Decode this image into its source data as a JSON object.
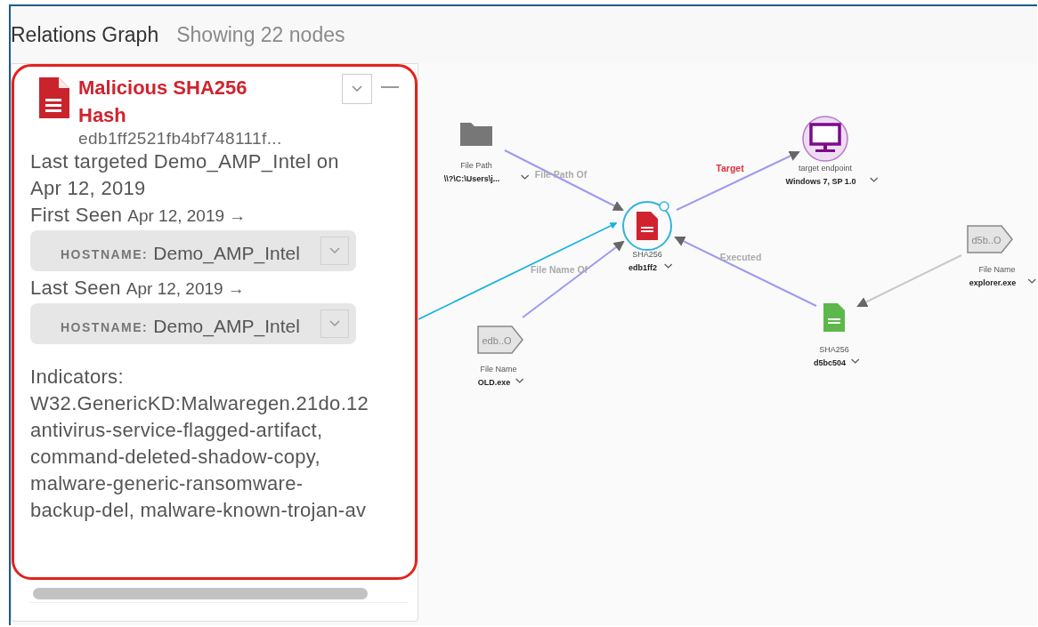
{
  "header": {
    "title": "Relations Graph",
    "subtitle": "Showing 22 nodes"
  },
  "panel": {
    "title": "Malicious SHA256 Hash",
    "hash": "edb1ff2521fb4bf748111f...",
    "summary": "Last targeted Demo_AMP_Intel on Apr 12, 2019",
    "sightings": [
      {
        "label": "First Seen",
        "date": "Apr 12, 2019 →",
        "host_key": "HOSTNAME:",
        "host": "Demo_AMP_Intel"
      },
      {
        "label": "Last Seen",
        "date": "Apr 12, 2019 →",
        "host_key": "HOSTNAME:",
        "host": "Demo_AMP_Intel"
      }
    ],
    "indicators_label": "Indicators:",
    "indicators": "W32.GenericKD:Malwaregen.21do.12 antivirus-service-flagged-artifact, command-deleted-shadow-copy, malware-generic-ransomware-backup-del, malware-known-trojan-av"
  },
  "graph": {
    "nodes": [
      {
        "kind": "folder",
        "type": "File Path",
        "value": "\\\\?\\C:\\Users\\j..."
      },
      {
        "kind": "file",
        "type": "SHA256",
        "value": "edb1ff2",
        "color": "#d0232f",
        "selected": true
      },
      {
        "kind": "endpoint",
        "type": "target endpoint",
        "value": "Windows 7, SP 1.0"
      },
      {
        "kind": "tag",
        "tag": "d5b..O",
        "type": "File Name",
        "value": "explorer.exe"
      },
      {
        "kind": "file",
        "type": "SHA256",
        "value": "d5bc504",
        "color": "#5cb84a",
        "selected": false
      },
      {
        "kind": "tag",
        "tag": "edb..O",
        "type": "File Name",
        "value": "OLD.exe"
      }
    ],
    "edges": [
      {
        "label": {
          "text": "File Path Of",
          "color": "#aaaaaa"
        },
        "color": "#9b9bf0"
      },
      {
        "label": {
          "text": "Target",
          "color": "#e0303a"
        },
        "color": "#9b9bf0"
      },
      {
        "label": {
          "text": "Executed",
          "color": "#aaaaaa"
        },
        "color": "#9b9bf0"
      },
      {
        "label": {
          "text": "File Name Of",
          "color": "#aaaaaa"
        },
        "color": "#9b9bf0"
      },
      {
        "color": "#c8c8c8"
      }
    ]
  }
}
